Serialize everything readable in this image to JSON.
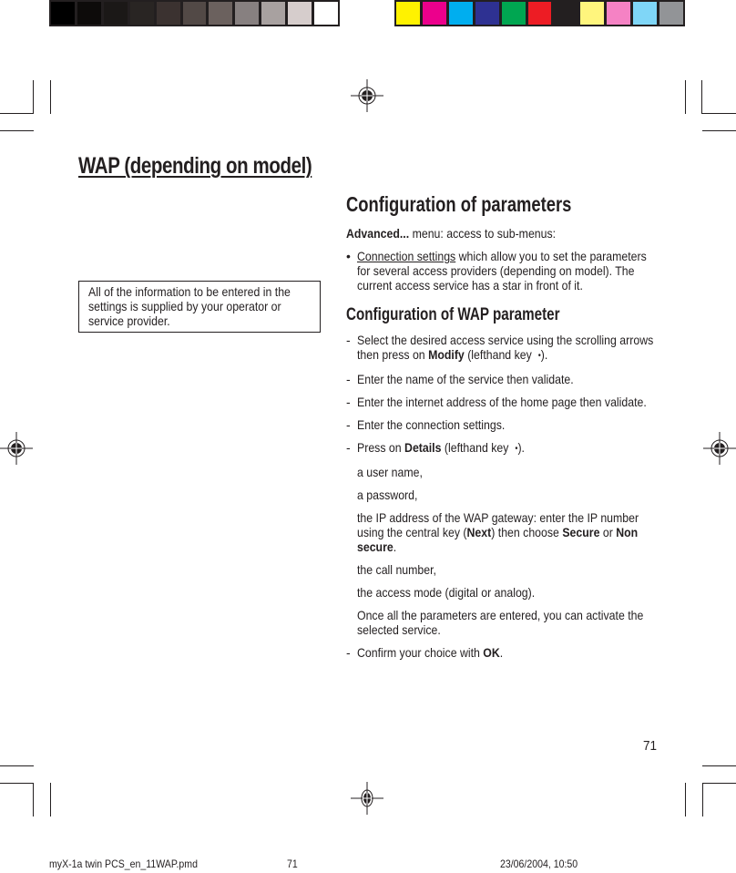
{
  "color_bars": {
    "grayscale": [
      "#000000",
      "#0d0b0a",
      "#1b1817",
      "#292523",
      "#3b3230",
      "#524946",
      "#6b615e",
      "#878080",
      "#a8a1a0",
      "#d6cdcc",
      "#ffffff"
    ],
    "process": [
      "#fff200",
      "#ec008c",
      "#00aeef",
      "#2e3192",
      "#00a651",
      "#ed1c24",
      "#231f20",
      "#fff57d",
      "#f582c4",
      "#7fd6f7",
      "#929497"
    ]
  },
  "header": {
    "section_title": "WAP (depending on model)"
  },
  "note": {
    "text": "All of the information to be entered in the settings is supplied by your operator or service provider."
  },
  "main": {
    "title": "Configuration of parameters",
    "intro": {
      "bold": "Advanced...",
      "rest": " menu: access to sub-menus:"
    },
    "bullet": {
      "mark": "•",
      "link": "Connection settings",
      "rest": " which allow you to set the parameters for several access providers (depending on model). The current access service has a star in front of it."
    },
    "subtitle": "Configuration of WAP parameter",
    "steps": [
      {
        "mark": "-",
        "before": "Select the desired access service using the scrolling arrows then press on ",
        "bold": "Modify",
        "after": " (lefthand key ",
        "key": "•",
        "end": ")."
      },
      {
        "mark": "-",
        "text": "Enter the name of the service then validate."
      },
      {
        "mark": "-",
        "text": "Enter the internet address of the home page then validate."
      },
      {
        "mark": "-",
        "text": "Enter the connection settings."
      },
      {
        "mark": "-",
        "before": "Press on ",
        "bold": "Details",
        "after": " (lefthand key ",
        "key": "•",
        "end": ")."
      }
    ],
    "details": {
      "user_name": "a user name,",
      "password": "a password,",
      "ip": {
        "before": "the IP address of the WAP gateway: enter the IP number using the central key (",
        "next": "Next",
        "middle": ") then choose ",
        "secure": "Secure",
        "or": " or ",
        "non_secure": "Non secure",
        "end": "."
      },
      "call_number": "the call number,",
      "access_mode": "the access mode (digital or analog).",
      "once": "Once all the parameters are entered, you can activate the selected service."
    },
    "confirm": {
      "mark": "-",
      "before": "Confirm your choice with ",
      "bold": "OK",
      "end": "."
    }
  },
  "page_number": "71",
  "footer": {
    "file": "myX-1a twin PCS_en_11WAP.pmd",
    "page": "71",
    "datetime": "23/06/2004, 10:50"
  }
}
